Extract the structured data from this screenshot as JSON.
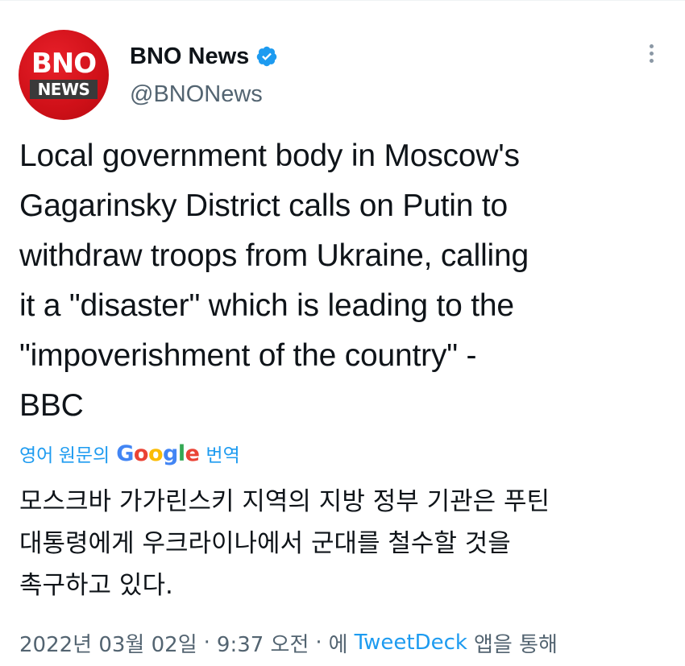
{
  "tweet": {
    "author": {
      "avatar_top": "BNO",
      "avatar_bottom": "NEWS",
      "display_name": "BNO News",
      "handle": "@BNONews",
      "verified": true,
      "avatar_color": "#d7141c"
    },
    "text": "Local government body in Moscow's\nGagarinsky District calls on Putin to\nwithdraw troops from Ukraine, calling\nit a \"disaster\" which is leading to the\n\"impoverishment of the country\" -\nBBC",
    "translation": {
      "prefix": "영어 원문의",
      "logo": [
        "G",
        "o",
        "o",
        "g",
        "l",
        "e"
      ],
      "suffix": "번역",
      "text": "모스크바 가가린스키 지역의 지방 정부 기관은 푸틴\n대통령에게 우크라이나에서 군대를 철수할 것을\n촉구하고 있다."
    },
    "meta": {
      "date": "2022년 03월 02일",
      "separator": "·",
      "time": "9:37 오전",
      "via_prefix": "에",
      "source": "TweetDeck",
      "via_suffix": "앱을 통해"
    }
  },
  "icons": {
    "verified": "verified-badge-icon",
    "more": "more-options-icon"
  },
  "colors": {
    "link": "#1d9bf0",
    "secondary_text": "#536471",
    "primary_text": "#0f1419"
  }
}
